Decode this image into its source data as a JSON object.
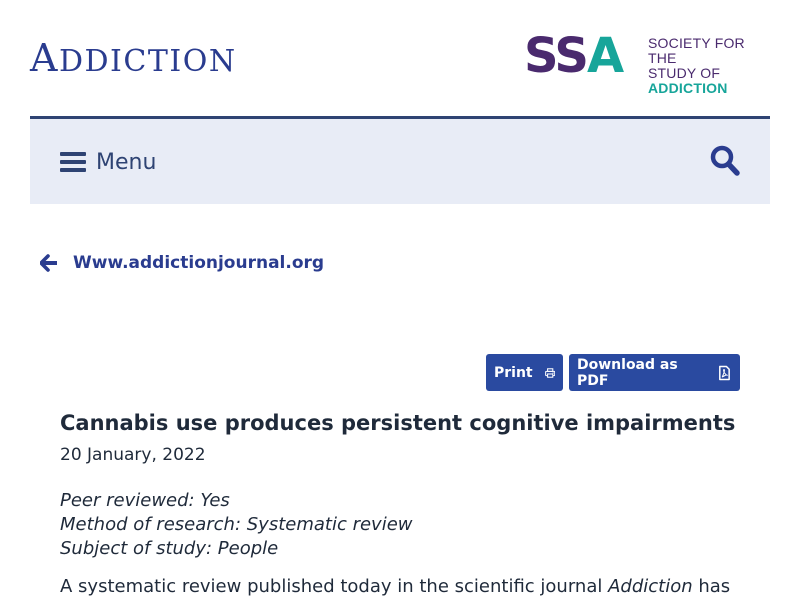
{
  "header": {
    "journal_logo_first": "A",
    "journal_logo_rest": "DDICTION",
    "society_logo_mark_s": "SS",
    "society_logo_mark_a": "A",
    "society_logo_line1": "SOCIETY FOR THE",
    "society_logo_line2": "STUDY OF",
    "society_logo_line3": "ADDICTION"
  },
  "nav": {
    "menu_label": "Menu",
    "menu_icon": "hamburger-icon",
    "search_icon": "search-icon"
  },
  "back_link": {
    "label": "Www.addictionjournal.org",
    "icon": "arrow-left-icon"
  },
  "actions": {
    "print_label": "Print",
    "print_icon": "printer-icon",
    "pdf_label": "Download as PDF",
    "pdf_icon": "pdf-file-icon"
  },
  "article": {
    "title": "Cannabis use produces persistent cognitive impairments",
    "date": "20 January, 2022",
    "peer_reviewed": "Peer reviewed: Yes",
    "method": "Method of research: Systematic review",
    "subject": "Subject of study: People",
    "intro_before": "A systematic review published today in the scientific journal ",
    "intro_journal": "Addiction",
    "intro_after": " has"
  },
  "colors": {
    "brand_blue": "#2a3c8f",
    "nav_bg": "#e8ecf6",
    "button_blue": "#2a4aa0",
    "ssa_purple": "#4a2a6e",
    "ssa_teal": "#17a59a"
  }
}
